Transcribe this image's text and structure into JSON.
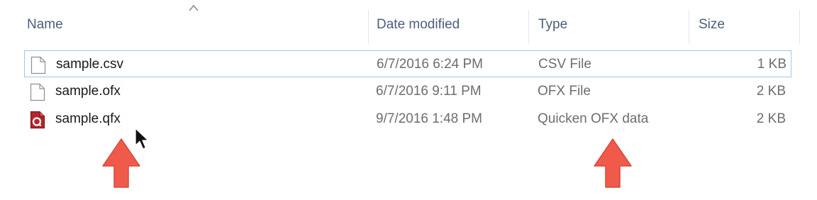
{
  "columns": {
    "name": "Name",
    "date_modified": "Date modified",
    "type": "Type",
    "size": "Size"
  },
  "sort": {
    "column": "name",
    "icon": "chevron-up-icon"
  },
  "files": [
    {
      "name": "sample.csv",
      "date": "6/7/2016 6:24 PM",
      "type": "CSV File",
      "size": "1 KB",
      "icon": "generic-file-icon",
      "selected": true
    },
    {
      "name": "sample.ofx",
      "date": "6/7/2016 9:11 PM",
      "type": "OFX File",
      "size": "2 KB",
      "icon": "generic-file-icon",
      "selected": false
    },
    {
      "name": "sample.qfx",
      "date": "9/7/2016 1:48 PM",
      "type": "Quicken OFX data",
      "size": "2 KB",
      "icon": "quicken-file-icon",
      "selected": false
    }
  ],
  "annotations": {
    "arrow_color": "#f05a4a",
    "arrow_icon": "red-up-arrow-icon"
  },
  "colors": {
    "selection_border": "#99c9ef",
    "header_text": "#4c607a",
    "quicken_red": "#b3262d"
  }
}
